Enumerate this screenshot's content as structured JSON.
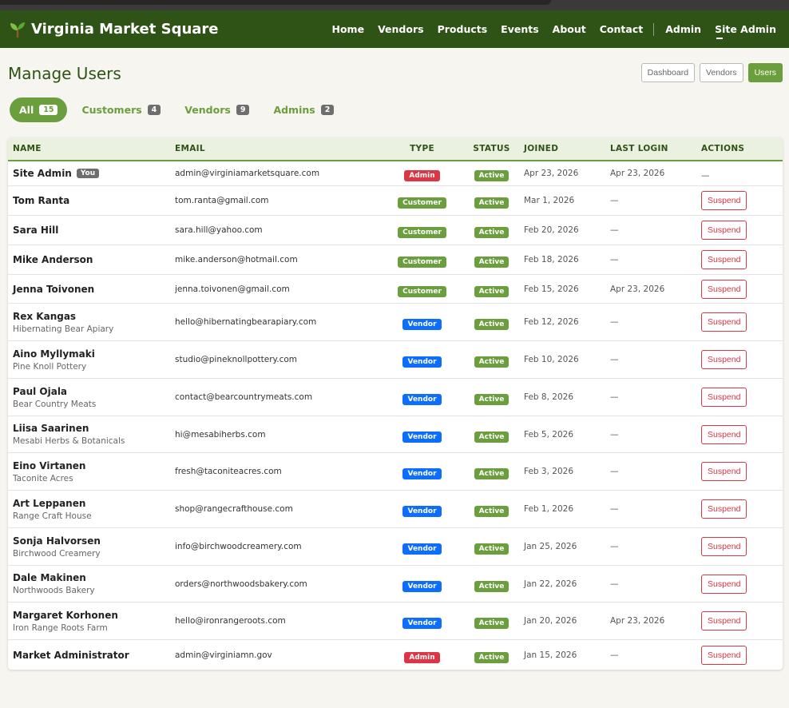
{
  "app": {
    "brand": "Virginia Market Square",
    "brand_icon": "sprout-icon"
  },
  "nav": {
    "items": [
      "Home",
      "Vendors",
      "Products",
      "Events",
      "About",
      "Contact"
    ],
    "admin": "Admin",
    "site_admin": "Site Admin"
  },
  "page": {
    "title": "Manage Users",
    "buttons": [
      "Dashboard",
      "Vendors",
      "Users"
    ],
    "active_button": "Users"
  },
  "filters": [
    {
      "label": "All",
      "count": "15",
      "active": true
    },
    {
      "label": "Customers",
      "count": "4",
      "active": false
    },
    {
      "label": "Vendors",
      "count": "9",
      "active": false
    },
    {
      "label": "Admins",
      "count": "2",
      "active": false
    }
  ],
  "table": {
    "headers": [
      "NAME",
      "EMAIL",
      "TYPE",
      "STATUS",
      "JOINED",
      "LAST LOGIN",
      "ACTIONS"
    ],
    "you_label": "You",
    "action_label": "Suspend",
    "rows": [
      {
        "name": "Site Admin",
        "sub": "",
        "you": true,
        "email": "admin@virginiamarketsquare.com",
        "type": "Admin",
        "status": "Active",
        "joined": "Apr 23, 2026",
        "last_login": "Apr 23, 2026",
        "action": "—"
      },
      {
        "name": "Tom Ranta",
        "sub": "",
        "email": "tom.ranta@gmail.com",
        "type": "Customer",
        "status": "Active",
        "joined": "Mar 1, 2026",
        "last_login": "—",
        "action": "Suspend"
      },
      {
        "name": "Sara Hill",
        "sub": "",
        "email": "sara.hill@yahoo.com",
        "type": "Customer",
        "status": "Active",
        "joined": "Feb 20, 2026",
        "last_login": "—",
        "action": "Suspend"
      },
      {
        "name": "Mike Anderson",
        "sub": "",
        "email": "mike.anderson@hotmail.com",
        "type": "Customer",
        "status": "Active",
        "joined": "Feb 18, 2026",
        "last_login": "—",
        "action": "Suspend"
      },
      {
        "name": "Jenna Toivonen",
        "sub": "",
        "email": "jenna.toivonen@gmail.com",
        "type": "Customer",
        "status": "Active",
        "joined": "Feb 15, 2026",
        "last_login": "Apr 23, 2026",
        "action": "Suspend"
      },
      {
        "name": "Rex Kangas",
        "sub": "Hibernating Bear Apiary",
        "email": "hello@hibernatingbearapiary.com",
        "type": "Vendor",
        "status": "Active",
        "joined": "Feb 12, 2026",
        "last_login": "—",
        "action": "Suspend"
      },
      {
        "name": "Aino Myllymaki",
        "sub": "Pine Knoll Pottery",
        "email": "studio@pineknollpottery.com",
        "type": "Vendor",
        "status": "Active",
        "joined": "Feb 10, 2026",
        "last_login": "—",
        "action": "Suspend"
      },
      {
        "name": "Paul Ojala",
        "sub": "Bear Country Meats",
        "email": "contact@bearcountrymeats.com",
        "type": "Vendor",
        "status": "Active",
        "joined": "Feb 8, 2026",
        "last_login": "—",
        "action": "Suspend"
      },
      {
        "name": "Liisa Saarinen",
        "sub": "Mesabi Herbs & Botanicals",
        "email": "hi@mesabiherbs.com",
        "type": "Vendor",
        "status": "Active",
        "joined": "Feb 5, 2026",
        "last_login": "—",
        "action": "Suspend"
      },
      {
        "name": "Eino Virtanen",
        "sub": "Taconite Acres",
        "email": "fresh@taconiteacres.com",
        "type": "Vendor",
        "status": "Active",
        "joined": "Feb 3, 2026",
        "last_login": "—",
        "action": "Suspend"
      },
      {
        "name": "Art Leppanen",
        "sub": "Range Craft House",
        "email": "shop@rangecrafthouse.com",
        "type": "Vendor",
        "status": "Active",
        "joined": "Feb 1, 2026",
        "last_login": "—",
        "action": "Suspend"
      },
      {
        "name": "Sonja Halvorsen",
        "sub": "Birchwood Creamery",
        "email": "info@birchwoodcreamery.com",
        "type": "Vendor",
        "status": "Active",
        "joined": "Jan 25, 2026",
        "last_login": "—",
        "action": "Suspend"
      },
      {
        "name": "Dale Makinen",
        "sub": "Northwoods Bakery",
        "email": "orders@northwoodsbakery.com",
        "type": "Vendor",
        "status": "Active",
        "joined": "Jan 22, 2026",
        "last_login": "—",
        "action": "Suspend"
      },
      {
        "name": "Margaret Korhonen",
        "sub": "Iron Range Roots Farm",
        "email": "hello@ironrangeroots.com",
        "type": "Vendor",
        "status": "Active",
        "joined": "Jan 20, 2026",
        "last_login": "Apr 23, 2026",
        "action": "Suspend"
      },
      {
        "name": "Market Administrator",
        "sub": "",
        "email": "admin@virginiamn.gov",
        "type": "Admin",
        "status": "Active",
        "joined": "Jan 15, 2026",
        "last_login": "—",
        "action": "Suspend"
      }
    ]
  },
  "colors": {
    "brand_green": "#2f5316",
    "accent_green": "#6b9e3c",
    "admin_red": "#dc3545",
    "vendor_blue": "#0d6efd"
  }
}
